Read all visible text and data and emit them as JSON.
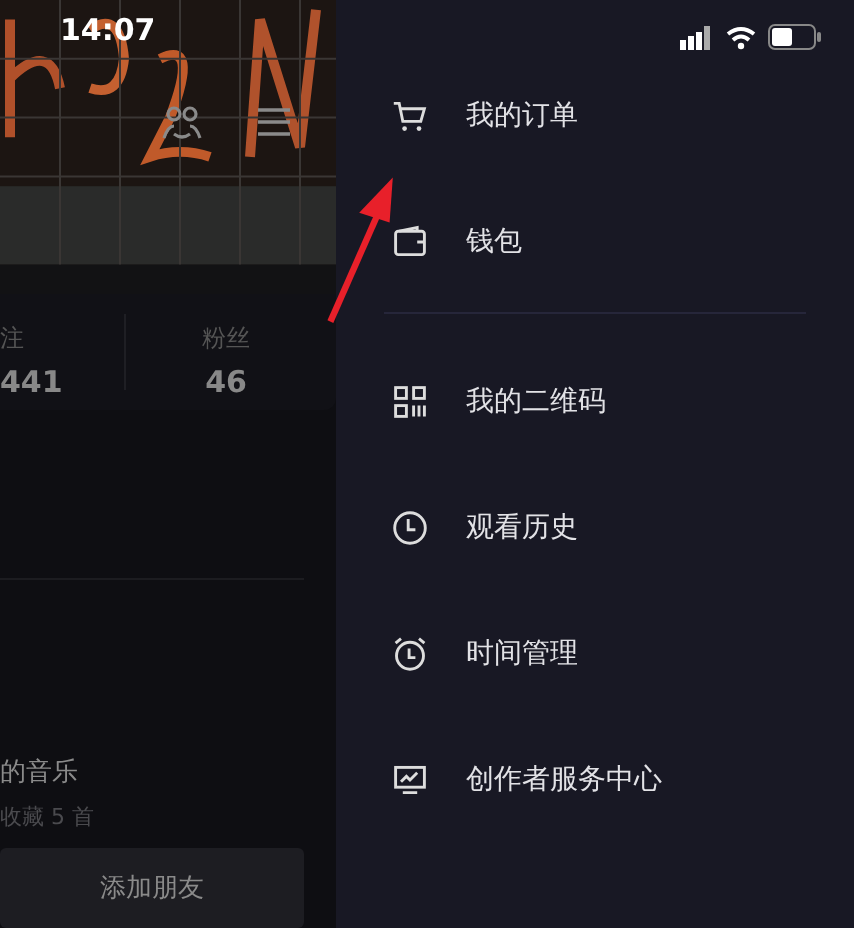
{
  "status_bar": {
    "time": "14:07"
  },
  "profile": {
    "stats": [
      {
        "label": "注",
        "value": "441"
      },
      {
        "label": "粉丝",
        "value": "46"
      }
    ],
    "music": {
      "title": "的音乐",
      "subtitle": "收藏 5 首"
    },
    "button": "添加朋友"
  },
  "drawer": {
    "sections": [
      {
        "items": [
          {
            "kind": "cart",
            "label": "我的订单"
          },
          {
            "kind": "wallet",
            "label": "钱包"
          }
        ]
      },
      {
        "items": [
          {
            "kind": "qr",
            "label": "我的二维码"
          },
          {
            "kind": "clock",
            "label": "观看历史"
          },
          {
            "kind": "alarm",
            "label": "时间管理"
          },
          {
            "kind": "chart",
            "label": "创作者服务中心"
          }
        ]
      }
    ]
  }
}
